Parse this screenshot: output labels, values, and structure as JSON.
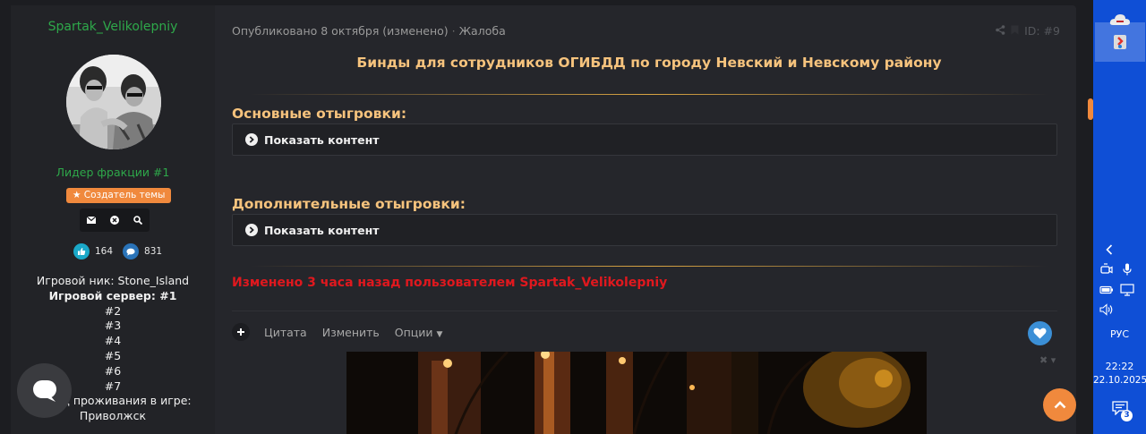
{
  "author": {
    "name": "Spartak_Velikolepniy",
    "title": "Лидер фракции #1",
    "badge": "Создатель темы",
    "likes": "164",
    "messages": "831",
    "nick_line": "Игровой ник: Stone_Island",
    "server_line": "Игровой сервер: #1",
    "servers": [
      "#2",
      "#3",
      "#4",
      "#5",
      "#6",
      "#7"
    ],
    "residence_label": "Город проживания в игре:",
    "residence_value": "Приволжск"
  },
  "post": {
    "meta_published": "Опубликовано 8 октября (изменено)",
    "meta_report": "Жалоба",
    "post_id": "ID: #9",
    "title": "Бинды для сотрудников ОГИБДД по городу Невский и Невскому району",
    "section_1_title": "Основные отыгровки:",
    "section_2_title": "Дополнительные отыгровки:",
    "spoiler_label": "Показать контент",
    "edited_text": "Изменено 3 часа назад пользователем Spartak_Velikolepniy",
    "actions": {
      "quote": "Цитата",
      "edit": "Изменить",
      "options": "Опции"
    }
  },
  "taskbar": {
    "language": "РУС",
    "time": "22:22",
    "date": "22.10.2025",
    "notifications": "3"
  },
  "colors": {
    "accent_orange": "#f0893d",
    "author_green": "#2ea84a",
    "title_gold": "#f6c37d",
    "edited_red": "#e0181e",
    "taskbar_blue": "#0f4fd6"
  }
}
